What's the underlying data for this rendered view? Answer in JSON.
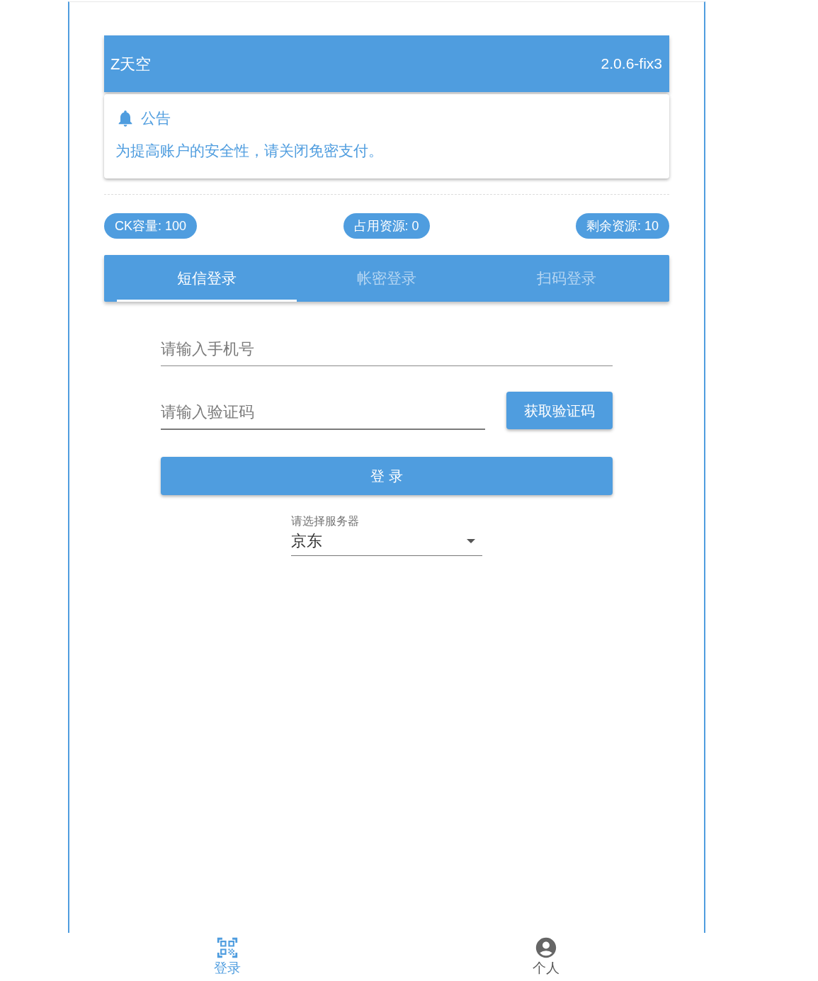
{
  "header": {
    "title": "Z天空",
    "version": "2.0.6-fix3"
  },
  "notice": {
    "title": "公告",
    "text": "为提高账户的安全性，请关闭免密支付。"
  },
  "stats": [
    "CK容量: 100",
    "占用资源: 0",
    "剩余资源: 10"
  ],
  "tabs": [
    {
      "label": "短信登录",
      "selected": true
    },
    {
      "label": "帐密登录",
      "selected": false
    },
    {
      "label": "扫码登录",
      "selected": false
    }
  ],
  "form": {
    "phone": {
      "placeholder": "请输入手机号"
    },
    "code": {
      "placeholder": "请输入验证码"
    },
    "send_code_button": "获取验证码",
    "login_button": "登 录",
    "server_select": {
      "label": "请选择服务器",
      "value": "京东"
    }
  },
  "bottom_nav": [
    {
      "kind": "qr",
      "label": "登录",
      "selected": true
    },
    {
      "kind": "account",
      "label": "个人",
      "selected": false
    }
  ]
}
